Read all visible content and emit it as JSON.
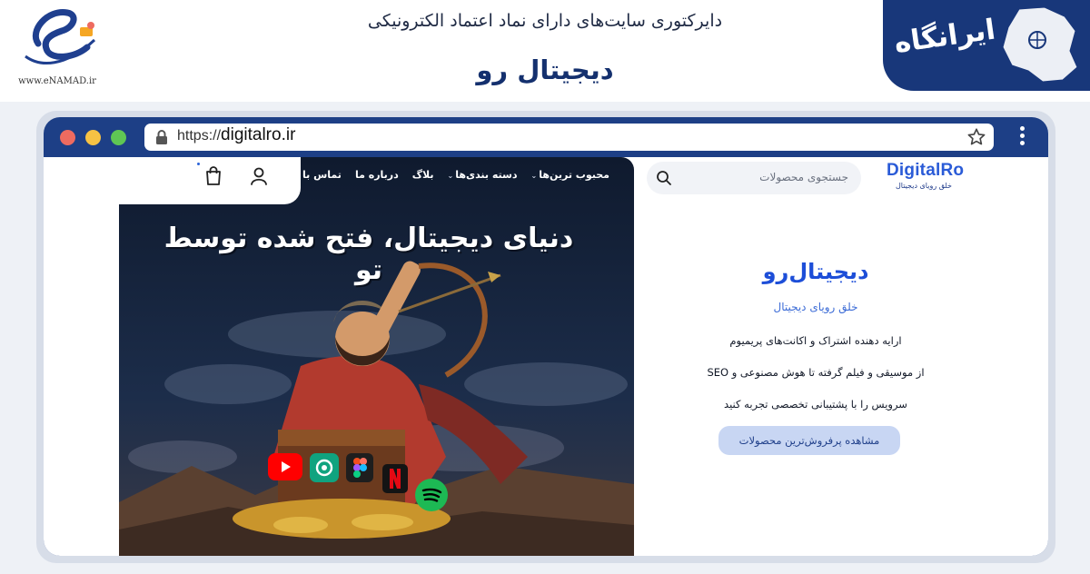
{
  "banner": {
    "enamad_text": "www.eNAMAD.ir",
    "directory_title": "دایرکتوری سایت‌های دارای نماد اعتماد الکترونیکی",
    "site_title": "دیجیتال رو",
    "irangah_text": "ایرانگاه"
  },
  "browser": {
    "url_protocol": "https://",
    "url_domain": "digitalro.ir"
  },
  "site": {
    "nav": [
      {
        "label": "محبوب ترین‌ها",
        "has_dropdown": true
      },
      {
        "label": "دسته بندی‌ها",
        "has_dropdown": true
      },
      {
        "label": "بلاگ",
        "has_dropdown": false
      },
      {
        "label": "درباره ما",
        "has_dropdown": false
      },
      {
        "label": "تماس با ما",
        "has_dropdown": false
      }
    ],
    "search_placeholder": "جستجوی محصولات",
    "brand_name": "DigitalRo",
    "brand_tagline": "خلق رویای دیجیتال",
    "hero_headline": "دنیای دیجیتال، فتح شده توسط تو",
    "side_title": "دیجیتال‌رو",
    "side_subtitle": "خلق رویای دیجیتال",
    "side_lines": [
      "ارایه دهنده اشتراک و اکانت‌های پریمیوم",
      "از موسیقی و فیلم گرفته تا هوش مصنوعی و SEO",
      "سرویس را با پشتیبانی تخصصی تجربه کنید"
    ],
    "cta_label": "مشاهده پرفروش‌ترین محصولات"
  },
  "icons": [
    "lock-icon",
    "star-icon",
    "kebab-menu-icon",
    "cart-icon",
    "user-icon",
    "search-icon",
    "youtube-icon",
    "chatgpt-icon",
    "figma-icon",
    "netflix-icon",
    "spotify-icon"
  ],
  "colors": {
    "brand_navy": "#1d3f86",
    "brand_blue": "#1d4ed8",
    "cta_bg": "#c8d6f3"
  }
}
